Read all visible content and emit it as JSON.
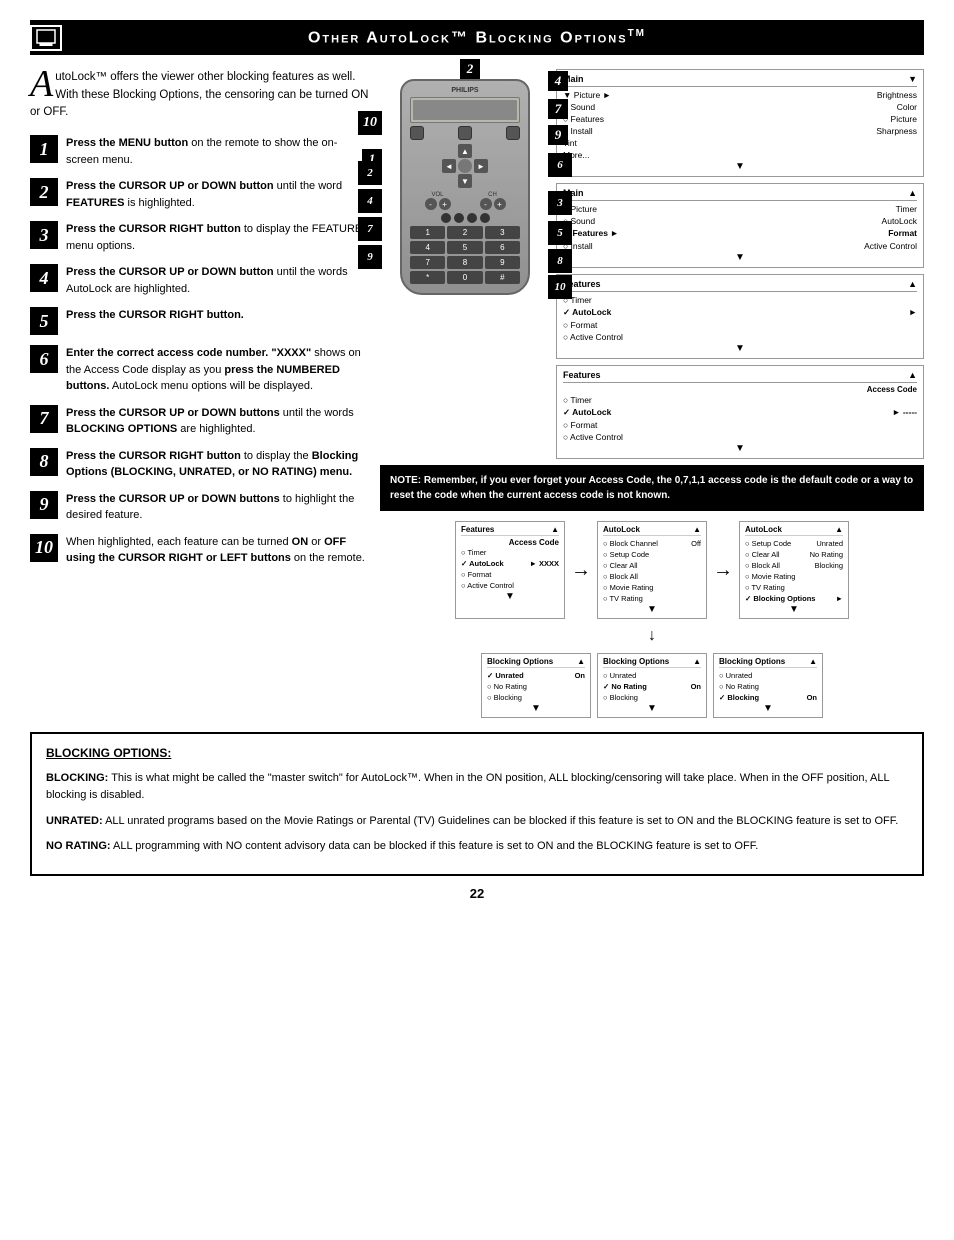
{
  "title": "Other AutoLock™ Blocking Options",
  "title_tm": "TM",
  "intro": {
    "drop_cap": "A",
    "text": "utoLock™ offers the viewer other blocking features as well. With these Blocking Options, the censoring can be turned ON or OFF."
  },
  "steps": [
    {
      "num": "1",
      "text": "Press the MENU button on the remote to show the on-screen menu."
    },
    {
      "num": "2",
      "text": "Press the CURSOR UP or DOWN button until the word FEATURES is highlighted."
    },
    {
      "num": "3",
      "text": "Press the CURSOR RIGHT button to display the FEATURES menu options."
    },
    {
      "num": "4",
      "text": "Press the CURSOR UP or DOWN button until the words AutoLock are highlighted."
    },
    {
      "num": "5",
      "text": "Press the CURSOR RIGHT button."
    },
    {
      "num": "6",
      "text": "Enter the correct access code number. \"XXXX\" shows on the Access Code display as you press the NUMBERED buttons. AutoLock menu options will be displayed."
    },
    {
      "num": "7",
      "text": "Press the CURSOR UP or DOWN buttons until the words BLOCKING OPTIONS are highlighted."
    },
    {
      "num": "8",
      "text": "Press the CURSOR RIGHT button to display the Blocking Options (BLOCKING, UNRATED, or NO RATING) menu."
    },
    {
      "num": "9",
      "text": "Press the CURSOR UP or DOWN buttons to highlight the desired feature."
    },
    {
      "num": "10",
      "text": "When highlighted, each feature can be turned ON or OFF using the CURSOR RIGHT or LEFT buttons on the remote."
    }
  ],
  "note": {
    "label": "NOTE:",
    "text": "Remember, if you ever forget your Access Code, the 0,7,1,1 access code is the default code or a way to reset the code when the current access code is not known."
  },
  "menu1": {
    "title": "Main",
    "arrow": "▼",
    "items": [
      {
        "label": "Picture",
        "type": "arrow",
        "right": "Brightness"
      },
      {
        "label": "Sound",
        "type": "circle",
        "right": "Color"
      },
      {
        "label": "Features",
        "type": "circle",
        "right": "Picture"
      },
      {
        "label": "Install",
        "type": "circle",
        "right": "Sharpness"
      },
      {
        "label": "",
        "right": "Tint"
      },
      {
        "label": "",
        "right": "More..."
      }
    ]
  },
  "menu2": {
    "title": "Main",
    "arrow": "▲",
    "items": [
      {
        "label": "Picture",
        "type": "circle",
        "right": "Timer"
      },
      {
        "label": "Sound",
        "type": "circle",
        "right": "AutoLock"
      },
      {
        "label": "Features",
        "type": "check",
        "right": "Format"
      },
      {
        "label": "Install",
        "type": "circle",
        "right": "Active Control"
      }
    ]
  },
  "menu3": {
    "title": "Features",
    "arrow": "▲",
    "items": [
      {
        "label": "Timer",
        "type": "circle"
      },
      {
        "label": "AutoLock",
        "type": "check",
        "right": "►"
      },
      {
        "label": "Format",
        "type": "circle"
      },
      {
        "label": "Active Control",
        "type": "circle"
      }
    ]
  },
  "menu4": {
    "title": "Features",
    "arrow": "▲",
    "items": [
      {
        "label": "Timer",
        "type": "circle"
      },
      {
        "label": "AutoLock",
        "type": "check",
        "right": "►"
      },
      {
        "label": "Format",
        "type": "circle"
      },
      {
        "label": "Active Control",
        "type": "circle"
      }
    ],
    "extra": "Access Code"
  },
  "menus_bottom_row1": [
    {
      "title": "Features",
      "arrow": "▲",
      "items": [
        {
          "label": "Timer",
          "type": "circle"
        },
        {
          "label": "AutoLock",
          "type": "check",
          "right": "► XXXX"
        },
        {
          "label": "Format",
          "type": "circle"
        },
        {
          "label": "Active Control",
          "type": "circle"
        }
      ],
      "extra": "Access Code"
    },
    {
      "title": "AutoLock",
      "arrow": "▲",
      "items": [
        {
          "label": "Block Channel",
          "type": "circle",
          "right": "Off"
        },
        {
          "label": "Setup Code",
          "type": "circle"
        },
        {
          "label": "Clear All",
          "type": "circle"
        },
        {
          "label": "Block All",
          "type": "circle"
        },
        {
          "label": "Movie Rating",
          "type": "circle"
        },
        {
          "label": "TV Rating",
          "type": "circle"
        }
      ]
    },
    {
      "title": "AutoLock",
      "arrow": "▲",
      "items": [
        {
          "label": "Setup Code",
          "type": "circle",
          "right": "Unrated"
        },
        {
          "label": "Clear All",
          "type": "circle",
          "right": "No Rating"
        },
        {
          "label": "Block All",
          "type": "circle",
          "right": "Blocking"
        },
        {
          "label": "Movie Rating",
          "type": "circle"
        },
        {
          "label": "TV Rating",
          "type": "circle"
        },
        {
          "label": "Blocking Options",
          "type": "check",
          "right": "►"
        }
      ]
    }
  ],
  "menus_bottom_row2": [
    {
      "title": "Blocking Options",
      "arrow": "▲",
      "items": [
        {
          "label": "Unrated",
          "type": "check",
          "right": "On"
        },
        {
          "label": "No Rating",
          "type": "circle"
        },
        {
          "label": "Blocking",
          "type": "circle"
        }
      ]
    },
    {
      "title": "Blocking Options",
      "arrow": "▲",
      "items": [
        {
          "label": "Unrated",
          "type": "circle"
        },
        {
          "label": "No Rating",
          "type": "check",
          "right": "On"
        },
        {
          "label": "Blocking",
          "type": "circle"
        }
      ]
    },
    {
      "title": "Blocking Options",
      "arrow": "▲",
      "items": [
        {
          "label": "Unrated",
          "type": "circle"
        },
        {
          "label": "No Rating",
          "type": "circle"
        },
        {
          "label": "Blocking",
          "type": "check",
          "right": "On"
        }
      ]
    }
  ],
  "blocking_options": {
    "title": "BLOCKING OPTIONS:",
    "sections": [
      {
        "term": "BLOCKING:",
        "definition": "This is what might be called the \"master switch\" for AutoLock™. When in the ON position, ALL blocking/censoring will take place. When in the OFF position, ALL blocking is disabled."
      },
      {
        "term": "UNRATED:",
        "definition": "ALL unrated programs based on the Movie Ratings or Parental (TV) Guidelines can be blocked if this feature is set to ON and the BLOCKING feature is set to OFF."
      },
      {
        "term": "NO RATING:",
        "definition": "ALL programming with NO content advisory data can be blocked if this feature is set to ON and the BLOCKING feature is set to OFF."
      }
    ]
  },
  "page_number": "22"
}
